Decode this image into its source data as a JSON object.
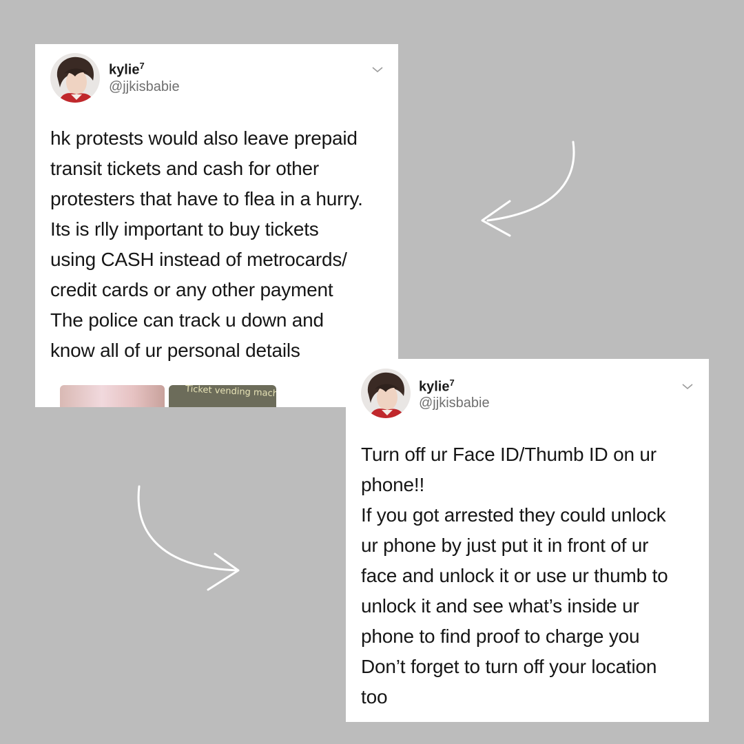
{
  "tweets": [
    {
      "display_name": "kylie",
      "name_superscript": "7",
      "handle": "@jjkisbabie",
      "lines": [
        "hk protests would also leave prepaid",
        "transit tickets and cash for other",
        "protesters that have to flea in a hurry.",
        "Its is rlly important to buy tickets",
        "using CASH instead of metrocards/",
        "credit cards or any other payment",
        "The police can track u down and",
        "know all of ur personal details"
      ],
      "media_label": "Ticket vending machi"
    },
    {
      "display_name": "kylie",
      "name_superscript": "7",
      "handle": "@jjkisbabie",
      "lines": [
        "Turn off ur Face ID/Thumb ID on ur",
        "phone!!",
        "If you got arrested they could unlock",
        "ur phone by just put it in front of ur",
        "face and unlock it or use ur thumb to",
        "unlock it and see what’s inside ur",
        "phone to find proof to charge you",
        "Don’t forget to turn off your location",
        "too"
      ]
    }
  ],
  "icons": {
    "chevron": "chevron-down-icon",
    "arrow": "curved-arrow-icon"
  },
  "colors": {
    "background": "#bcbcbc",
    "card": "#ffffff",
    "text": "#161616",
    "handle": "#6f6f6f"
  }
}
